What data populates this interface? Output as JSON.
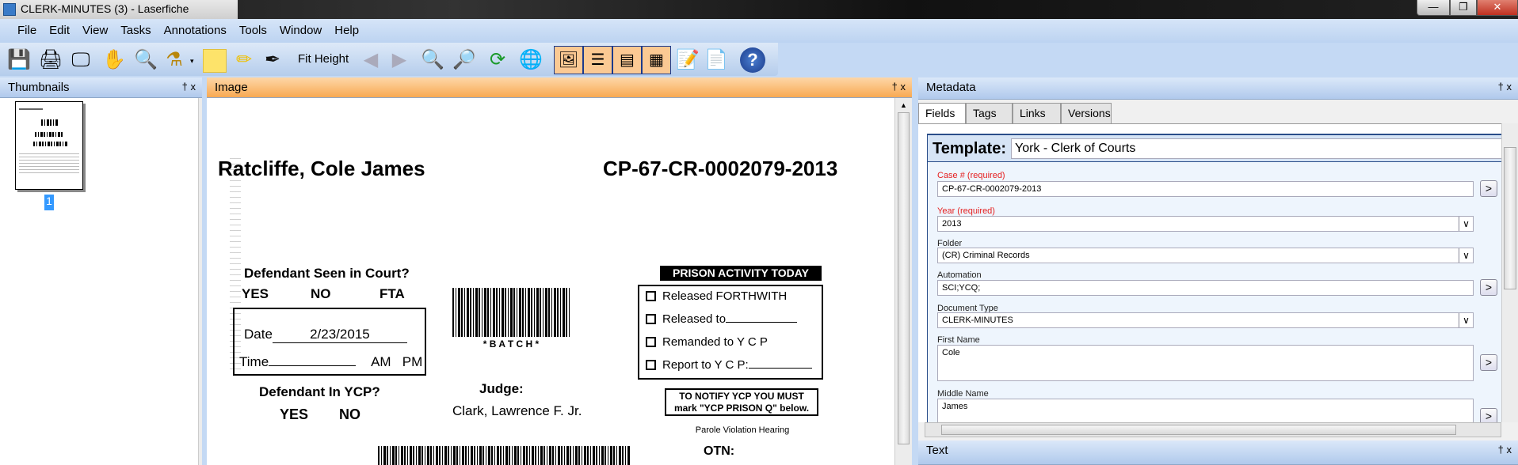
{
  "window": {
    "title": "CLERK-MINUTES (3) - Laserfiche",
    "minimize": "—",
    "restore": "❐",
    "close": "✕"
  },
  "menu": [
    "File",
    "Edit",
    "View",
    "Tasks",
    "Annotations",
    "Tools",
    "Window",
    "Help"
  ],
  "toolbar": {
    "fit_label": "Fit Height"
  },
  "thumbnails": {
    "title": "Thumbnails",
    "page_label": "1",
    "pin": "†",
    "close": "x"
  },
  "image": {
    "title": "Image",
    "pin": "†",
    "close": "x"
  },
  "document": {
    "name": "Ratcliffe, Cole James",
    "case": "CP-67-CR-0002079-2013",
    "seen_q": "Defendant Seen in Court?",
    "yes": "YES",
    "no": "NO",
    "fta": "FTA",
    "date_label": "Date",
    "date": "2/23/2015",
    "time_label": "Time",
    "am": "AM",
    "pm": "PM",
    "batch": "* B A T C H *",
    "ycp_q": "Defendant In YCP?",
    "yes2": "YES",
    "no2": "NO",
    "judge_label": "Judge:",
    "judge": "Clark, Lawrence F. Jr.",
    "prison_header": "PRISON ACTIVITY TODAY",
    "prison_items": [
      "Released    FORTHWITH",
      "Released to",
      "Remanded to Y C P",
      "Report to Y C P:"
    ],
    "notify": "TO NOTIFY YCP YOU MUST mark \"YCP PRISON Q\" below.",
    "parole": "Parole Violation Hearing",
    "otn": "OTN:"
  },
  "metadata": {
    "title": "Metadata",
    "pin": "†",
    "close": "x",
    "tabs": [
      "Fields",
      "Tags",
      "Links",
      "Versions"
    ],
    "template_label": "Template:",
    "template": "York - Clerk of Courts",
    "fields": [
      {
        "label": "Case # (required)",
        "value": "CP-67-CR-0002079-2013"
      },
      {
        "label": "Year (required)",
        "value": "2013"
      },
      {
        "label": "Folder",
        "value": "(CR) Criminal Records"
      },
      {
        "label": "Automation",
        "value": "SCI;YCQ;"
      },
      {
        "label": "Document Type",
        "value": "CLERK-MINUTES"
      },
      {
        "label": "First Name",
        "value": "Cole"
      },
      {
        "label": "Middle Name",
        "value": "James"
      }
    ],
    "button": ">"
  },
  "text_panel": {
    "title": "Text",
    "pin": "†",
    "close": "x"
  },
  "colors": {
    "accent_orange": "#f8a952",
    "required": "#e52020",
    "chrome_blue": "#c4d9f4"
  }
}
